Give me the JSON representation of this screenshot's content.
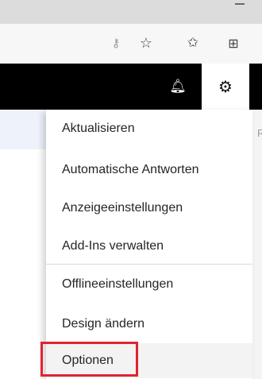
{
  "browser": {
    "icons": {
      "minimize": "minimize-icon",
      "key": "key-icon",
      "add_favorite": "star-add-icon",
      "favorites": "favorites-list-icon",
      "collections": "collections-icon"
    }
  },
  "appbar": {
    "icons": {
      "notifications": "bell-icon",
      "settings": "gear-icon"
    }
  },
  "background": {
    "clipped_text": "R"
  },
  "settings_menu": {
    "items": [
      {
        "label": "Aktualisieren"
      },
      {
        "label": "Automatische Antworten"
      },
      {
        "label": "Anzeigeeinstellungen"
      },
      {
        "label": "Add-Ins verwalten"
      },
      {
        "label": "Offlineeinstellungen"
      },
      {
        "label": "Design ändern"
      },
      {
        "label": "Optionen",
        "highlighted": true
      }
    ]
  },
  "colors": {
    "appbar": "#000000",
    "highlight": "#e0242f",
    "subbar": "#eef3fb"
  }
}
